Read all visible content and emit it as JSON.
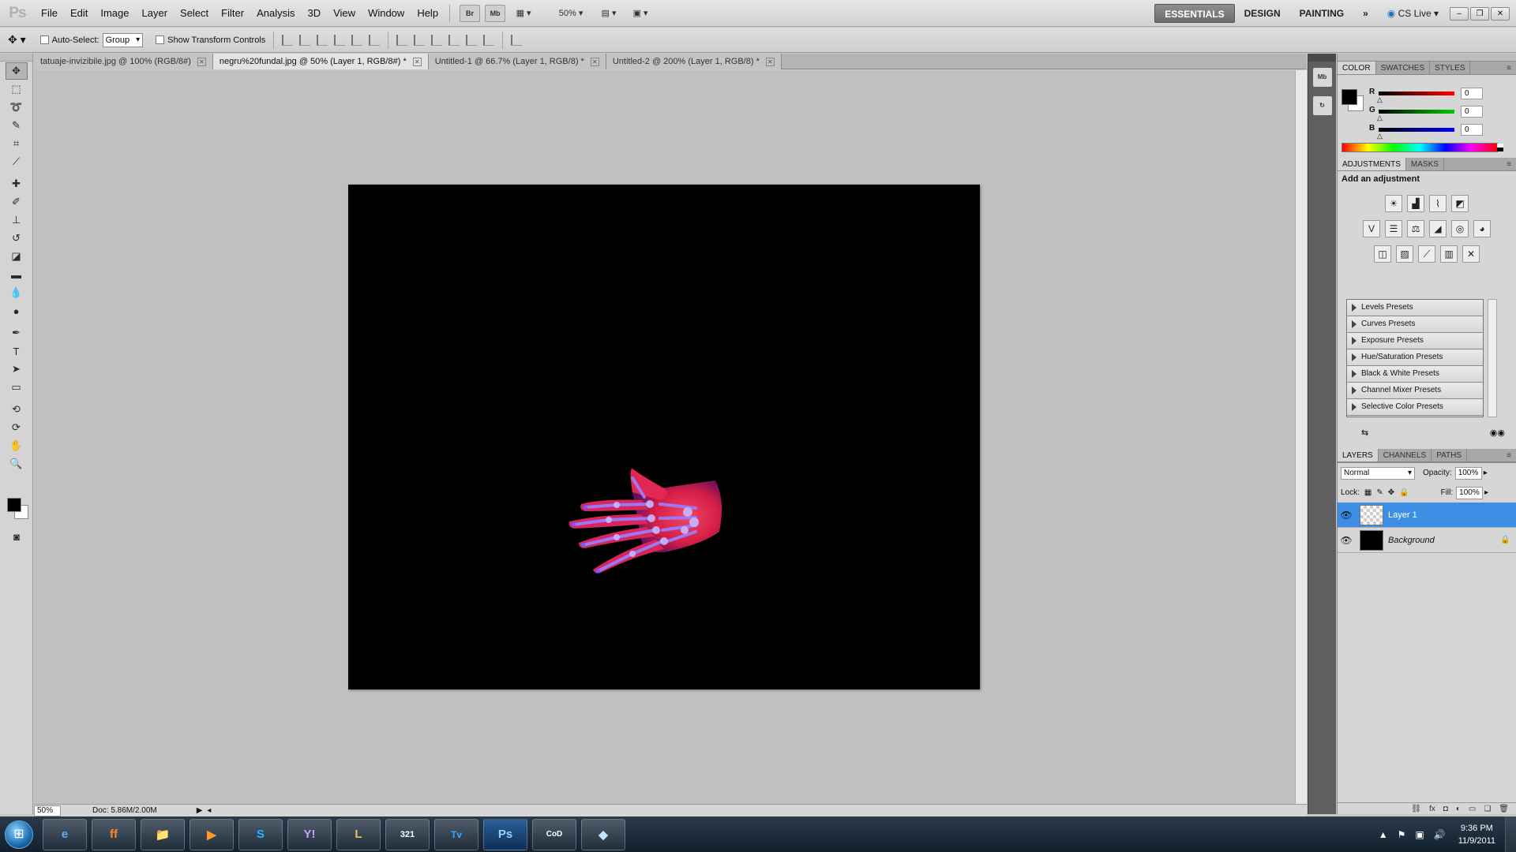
{
  "app": {
    "logo": "Ps",
    "menus": [
      "File",
      "Edit",
      "Image",
      "Layer",
      "Select",
      "Filter",
      "Analysis",
      "3D",
      "View",
      "Window",
      "Help"
    ],
    "menubar_buttons": [
      "Br",
      "Mb"
    ],
    "zoom": "50%",
    "workspaces": [
      "ESSENTIALS",
      "DESIGN",
      "PAINTING"
    ],
    "workspace_more": "»",
    "cs_live": "CS Live"
  },
  "options": {
    "auto_select_label": "Auto-Select:",
    "auto_select_value": "Group",
    "show_transform_label": "Show Transform Controls"
  },
  "tabs": [
    {
      "label": "tatuaje-invizibile.jpg @ 100% (RGB/8#)"
    },
    {
      "label": "negru%20fundal.jpg @ 50% (Layer 1, RGB/8#) *"
    },
    {
      "label": "Untitled-1 @ 66.7% (Layer 1, RGB/8) *"
    },
    {
      "label": "Untitled-2 @ 200% (Layer 1, RGB/8) *"
    }
  ],
  "status": {
    "zoom": "50%",
    "doc": "Doc: 5.86M/2.00M"
  },
  "color_panel": {
    "tabs": [
      "COLOR",
      "SWATCHES",
      "STYLES"
    ],
    "r": "0",
    "g": "0",
    "b": "0",
    "r_label": "R",
    "g_label": "G",
    "b_label": "B"
  },
  "adjustments": {
    "tabs": [
      "ADJUSTMENTS",
      "MASKS"
    ],
    "title": "Add an adjustment",
    "presets": [
      "Levels Presets",
      "Curves Presets",
      "Exposure Presets",
      "Hue/Saturation Presets",
      "Black & White Presets",
      "Channel Mixer Presets",
      "Selective Color Presets"
    ]
  },
  "layers": {
    "tabs": [
      "LAYERS",
      "CHANNELS",
      "PATHS"
    ],
    "blend_mode": "Normal",
    "opacity_label": "Opacity:",
    "opacity": "100%",
    "lock_label": "Lock:",
    "fill_label": "Fill:",
    "fill": "100%",
    "items": [
      {
        "name": "Layer 1"
      },
      {
        "name": "Background"
      }
    ]
  },
  "taskbar": {
    "apps": [
      "e",
      "ff",
      "📁",
      "▶",
      "S",
      "Y!",
      "L",
      "321",
      "Tv",
      "Ps",
      "CoD",
      "◆"
    ],
    "time": "9:36 PM",
    "date": "11/9/2011"
  },
  "colors": {
    "selection": "#3d8fe5",
    "canvas": "#000000"
  }
}
